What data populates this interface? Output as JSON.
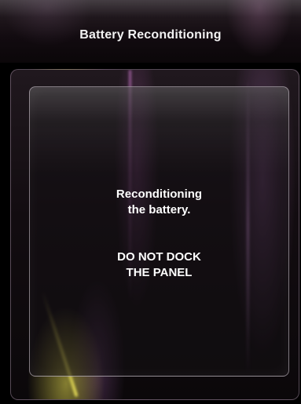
{
  "header": {
    "title": "Battery Reconditioning"
  },
  "message": {
    "line1": "Reconditioning",
    "line2": "the battery.",
    "line3": "DO NOT DOCK",
    "line4": "THE PANEL"
  },
  "colors": {
    "background": "#000000",
    "text": "#ffffff",
    "accent_glow_purple": "#b070c0",
    "accent_glow_yellow": "#e6dc50"
  }
}
